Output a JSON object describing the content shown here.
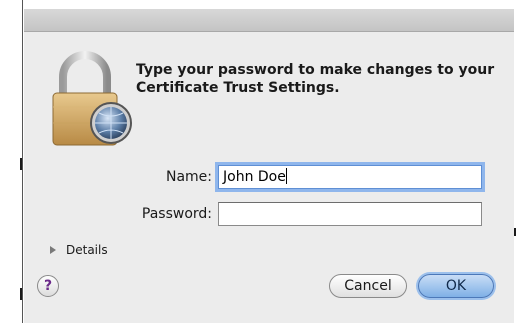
{
  "dialog": {
    "message": "Type your password to make changes to your Certificate Trust Settings.",
    "name_label": "Name:",
    "name_value": "John Doe",
    "password_label": "Password:",
    "password_value": "",
    "details_label": "Details",
    "help_label": "?",
    "cancel_label": "Cancel",
    "ok_label": "OK"
  },
  "icons": {
    "lock": "lock-icon",
    "disclosure": "disclosure-triangle-icon",
    "help": "help-icon"
  },
  "colors": {
    "dialog_bg": "#ececec",
    "focus_ring": "#8fb6ec",
    "ok_button": "#7fb0e6",
    "help_glyph": "#6b2a8a"
  }
}
